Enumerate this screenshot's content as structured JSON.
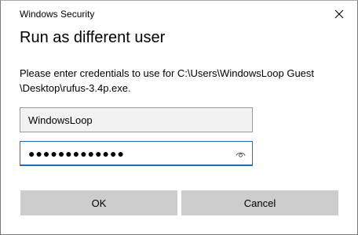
{
  "window": {
    "title": "Windows Security",
    "close_icon": "close-icon"
  },
  "dialog": {
    "heading": "Run as different user",
    "message_line1": "Please enter credentials to use for C:\\Users\\WindowsLoop Guest",
    "message_line2": "\\Desktop\\rufus-3.4p.exe."
  },
  "fields": {
    "username_value": "WindowsLoop",
    "password_masked": "●●●●●●●●●●●●●",
    "reveal_icon": "eye-icon"
  },
  "buttons": {
    "ok_label": "OK",
    "cancel_label": "Cancel"
  },
  "colors": {
    "focus_border": "#1a6fc2",
    "button_bg": "#cccccc",
    "input_bg": "#f2f2f2"
  }
}
